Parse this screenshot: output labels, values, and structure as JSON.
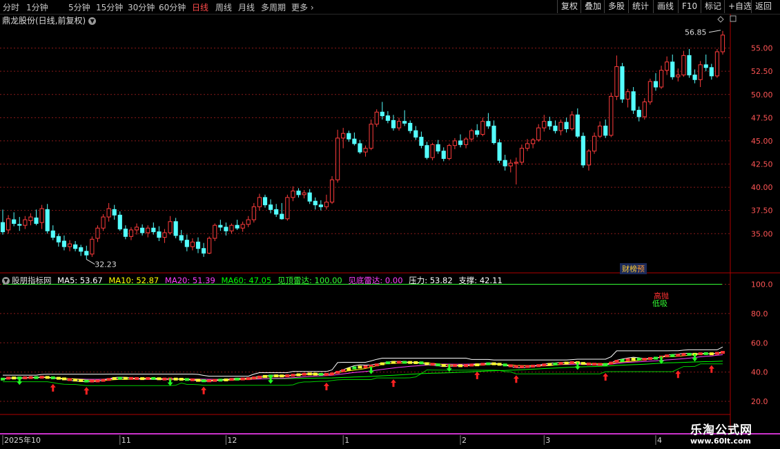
{
  "toolbar": {
    "periods": [
      "分时",
      "1分钟",
      "5分钟",
      "15分钟",
      "30分钟",
      "60分钟",
      "日线",
      "周线",
      "月线",
      "多周期",
      "更多"
    ],
    "active_period": "日线",
    "right_buttons": [
      "复权",
      "叠加",
      "多股",
      "统计",
      "画线",
      "F10",
      "标记",
      "+自选",
      "返回"
    ]
  },
  "main_title": "鼎龙股份(日线,前复权)",
  "marks": {
    "high_label": "56.85",
    "low_label": "32.23",
    "caibang": "财榜",
    "yu": "预"
  },
  "indicator": {
    "name": "股朋指标网",
    "ma5": "MA5: 53.67",
    "ma10": "MA10: 52.87",
    "ma20": "MA20: 51.39",
    "ma60": "MA60: 47.05",
    "top_radar": "见顶雷达: 100.00",
    "bottom_radar": "见底雷达: 0.00",
    "pressure": "压力: 53.82",
    "support": "支撑: 42.11",
    "label_high": "高抛",
    "label_low": "低吸"
  },
  "colors": {
    "up": "#ff3c3c",
    "down": "#54ffff",
    "ma5": "#ffffff",
    "ma10": "#ffff00",
    "ma20": "#ff40ff",
    "ma60": "#00ff00",
    "grid": "#8b1a1a",
    "axis": "#b00000"
  },
  "x_axis_labels": [
    "2025年10",
    "11",
    "12",
    "1",
    "2",
    "3",
    "4"
  ],
  "watermark": {
    "line1": "乐淘公式网",
    "line2": "www.60lt.com"
  },
  "chart_data": [
    {
      "type": "candlestick",
      "title": "鼎龙股份(日线,前复权)",
      "y_ticks": [
        35.0,
        37.5,
        40.0,
        42.5,
        45.0,
        47.5,
        50.0,
        52.5,
        55.0
      ],
      "ylim": [
        31.0,
        57.5
      ],
      "high": 56.85,
      "low": 32.23,
      "candles": [
        [
          36.2,
          37.6,
          34.9,
          35.2
        ],
        [
          35.4,
          37.0,
          35.0,
          36.6
        ],
        [
          36.5,
          37.3,
          35.8,
          36.1
        ],
        [
          36.0,
          36.8,
          35.3,
          35.9
        ],
        [
          35.9,
          36.9,
          35.5,
          36.5
        ],
        [
          36.4,
          37.2,
          35.9,
          36.8
        ],
        [
          36.7,
          37.6,
          35.9,
          36.1
        ],
        [
          36.2,
          38.1,
          35.5,
          37.7
        ],
        [
          37.6,
          38.2,
          35.0,
          35.3
        ],
        [
          35.3,
          35.9,
          34.3,
          34.6
        ],
        [
          34.7,
          35.0,
          33.6,
          34.1
        ],
        [
          34.2,
          34.8,
          33.2,
          33.6
        ],
        [
          33.6,
          34.3,
          33.1,
          33.9
        ],
        [
          33.8,
          34.2,
          33.1,
          33.4
        ],
        [
          33.5,
          33.8,
          32.6,
          33.1
        ],
        [
          33.1,
          33.7,
          32.23,
          32.7
        ],
        [
          32.8,
          34.7,
          32.5,
          34.4
        ],
        [
          34.5,
          35.9,
          34.1,
          35.6
        ],
        [
          35.6,
          37.1,
          35.3,
          36.8
        ],
        [
          36.8,
          38.3,
          36.3,
          37.7
        ],
        [
          37.6,
          38.1,
          36.5,
          37.0
        ],
        [
          37.0,
          37.4,
          35.3,
          35.5
        ],
        [
          35.5,
          35.9,
          34.4,
          34.7
        ],
        [
          34.7,
          35.7,
          34.3,
          35.4
        ],
        [
          35.4,
          36.1,
          34.9,
          35.7
        ],
        [
          35.6,
          36.0,
          34.8,
          35.1
        ],
        [
          35.1,
          35.9,
          34.6,
          35.6
        ],
        [
          35.6,
          36.2,
          34.9,
          35.2
        ],
        [
          35.2,
          35.8,
          34.2,
          34.6
        ],
        [
          34.6,
          35.5,
          34.0,
          35.1
        ],
        [
          35.1,
          36.9,
          34.9,
          36.3
        ],
        [
          36.3,
          36.7,
          34.5,
          34.8
        ],
        [
          34.8,
          35.4,
          34.0,
          34.3
        ],
        [
          34.3,
          34.9,
          33.1,
          33.6
        ],
        [
          33.6,
          34.5,
          33.2,
          34.1
        ],
        [
          34.1,
          34.6,
          32.9,
          33.4
        ],
        [
          33.4,
          34.0,
          32.5,
          32.9
        ],
        [
          32.9,
          34.7,
          32.8,
          34.5
        ],
        [
          34.5,
          36.1,
          34.2,
          35.9
        ],
        [
          35.9,
          36.5,
          35.3,
          35.7
        ],
        [
          35.7,
          36.2,
          34.8,
          35.3
        ],
        [
          35.3,
          36.1,
          35.0,
          35.9
        ],
        [
          35.9,
          36.5,
          35.4,
          35.6
        ],
        [
          35.6,
          36.3,
          35.2,
          36.0
        ],
        [
          36.0,
          36.9,
          35.7,
          36.5
        ],
        [
          36.5,
          38.3,
          36.2,
          37.9
        ],
        [
          37.9,
          39.3,
          37.5,
          38.9
        ],
        [
          38.9,
          39.2,
          37.8,
          38.1
        ],
        [
          38.1,
          38.7,
          37.2,
          37.6
        ],
        [
          37.6,
          38.2,
          36.8,
          37.1
        ],
        [
          37.1,
          38.3,
          36.5,
          36.6
        ],
        [
          36.6,
          39.2,
          36.4,
          38.9
        ],
        [
          38.9,
          40.1,
          38.5,
          39.6
        ],
        [
          39.6,
          39.9,
          38.9,
          39.2
        ],
        [
          39.2,
          39.7,
          38.8,
          39.4
        ],
        [
          39.4,
          39.8,
          38.2,
          38.5
        ],
        [
          38.5,
          38.9,
          37.6,
          38.1
        ],
        [
          38.1,
          38.6,
          37.5,
          37.9
        ],
        [
          37.9,
          39.2,
          37.6,
          38.4
        ],
        [
          38.4,
          41.2,
          38.2,
          40.8
        ],
        [
          40.8,
          46.2,
          40.5,
          45.3
        ],
        [
          45.3,
          46.4,
          44.2,
          45.8
        ],
        [
          45.8,
          46.1,
          44.9,
          45.2
        ],
        [
          45.2,
          45.9,
          44.5,
          44.7
        ],
        [
          44.7,
          45.1,
          43.6,
          43.8
        ],
        [
          43.8,
          44.5,
          43.3,
          44.2
        ],
        [
          44.2,
          47.3,
          44.0,
          46.8
        ],
        [
          46.8,
          48.4,
          46.5,
          48.1
        ],
        [
          48.1,
          49.2,
          47.3,
          47.7
        ],
        [
          47.7,
          48.2,
          46.9,
          47.2
        ],
        [
          47.2,
          47.8,
          46.1,
          46.4
        ],
        [
          46.4,
          47.5,
          46.1,
          47.1
        ],
        [
          47.1,
          48.3,
          46.6,
          46.9
        ],
        [
          46.9,
          47.2,
          45.8,
          46.1
        ],
        [
          46.1,
          46.6,
          45.1,
          45.4
        ],
        [
          45.4,
          46.0,
          44.2,
          44.5
        ],
        [
          44.5,
          44.9,
          43.0,
          43.2
        ],
        [
          43.2,
          44.8,
          42.9,
          44.6
        ],
        [
          44.6,
          45.1,
          43.6,
          43.9
        ],
        [
          43.9,
          44.3,
          42.8,
          43.1
        ],
        [
          43.1,
          44.7,
          42.9,
          44.5
        ],
        [
          44.5,
          45.3,
          44.1,
          45.0
        ],
        [
          45.0,
          45.7,
          44.3,
          44.6
        ],
        [
          44.6,
          45.4,
          44.2,
          45.2
        ],
        [
          45.2,
          46.3,
          44.9,
          46.1
        ],
        [
          46.1,
          46.8,
          45.4,
          45.7
        ],
        [
          45.7,
          47.5,
          45.5,
          47.1
        ],
        [
          47.1,
          48.0,
          46.3,
          46.6
        ],
        [
          46.6,
          47.2,
          44.6,
          44.8
        ],
        [
          44.8,
          45.2,
          42.6,
          42.9
        ],
        [
          42.9,
          43.5,
          41.8,
          42.3
        ],
        [
          42.3,
          43.0,
          41.6,
          42.6
        ],
        [
          42.6,
          43.2,
          40.3,
          42.7
        ],
        [
          42.7,
          44.6,
          42.4,
          44.2
        ],
        [
          44.2,
          45.2,
          43.9,
          44.7
        ],
        [
          44.7,
          45.3,
          44.2,
          45.1
        ],
        [
          45.1,
          46.8,
          44.9,
          46.4
        ],
        [
          46.4,
          47.8,
          46.0,
          47.1
        ],
        [
          47.1,
          47.6,
          46.2,
          46.6
        ],
        [
          46.6,
          47.2,
          45.8,
          46.1
        ],
        [
          46.1,
          47.3,
          45.6,
          47.0
        ],
        [
          47.0,
          47.5,
          45.9,
          46.3
        ],
        [
          46.3,
          48.2,
          46.1,
          47.8
        ],
        [
          47.8,
          48.5,
          45.3,
          45.5
        ],
        [
          45.5,
          45.9,
          42.1,
          42.4
        ],
        [
          42.4,
          44.1,
          41.8,
          43.9
        ],
        [
          43.9,
          45.9,
          43.6,
          45.5
        ],
        [
          45.5,
          47.1,
          45.3,
          46.6
        ],
        [
          46.6,
          47.3,
          45.3,
          45.6
        ],
        [
          45.6,
          50.2,
          45.4,
          49.8
        ],
        [
          49.8,
          54.2,
          49.4,
          53.0
        ],
        [
          53.0,
          53.4,
          49.1,
          49.5
        ],
        [
          49.5,
          50.6,
          48.6,
          50.3
        ],
        [
          50.3,
          50.8,
          47.9,
          48.3
        ],
        [
          48.3,
          48.7,
          47.1,
          47.6
        ],
        [
          47.6,
          49.6,
          47.3,
          49.2
        ],
        [
          49.2,
          51.7,
          48.9,
          51.4
        ],
        [
          51.4,
          52.3,
          50.4,
          50.8
        ],
        [
          50.8,
          53.1,
          50.6,
          52.6
        ],
        [
          52.6,
          54.1,
          52.1,
          53.5
        ],
        [
          53.5,
          54.3,
          51.6,
          51.9
        ],
        [
          51.9,
          52.8,
          51.4,
          52.1
        ],
        [
          52.1,
          54.7,
          51.9,
          54.2
        ],
        [
          54.2,
          54.9,
          51.8,
          52.1
        ],
        [
          52.1,
          52.7,
          51.2,
          51.6
        ],
        [
          51.6,
          53.6,
          50.8,
          53.2
        ],
        [
          53.2,
          54.3,
          52.5,
          52.9
        ],
        [
          52.9,
          53.3,
          51.6,
          52.0
        ],
        [
          52.0,
          54.9,
          51.8,
          54.6
        ],
        [
          54.6,
          56.85,
          54.3,
          56.4
        ]
      ]
    },
    {
      "type": "line",
      "title": "股朋指标网",
      "y_ticks": [
        20.0,
        40.0,
        60.0,
        80.0,
        100.0
      ],
      "ylim": [
        12,
        104
      ],
      "top_radar_line": 100.0,
      "series_names": [
        "MA5",
        "MA10",
        "MA20",
        "MA60",
        "压力",
        "支撑"
      ]
    }
  ]
}
